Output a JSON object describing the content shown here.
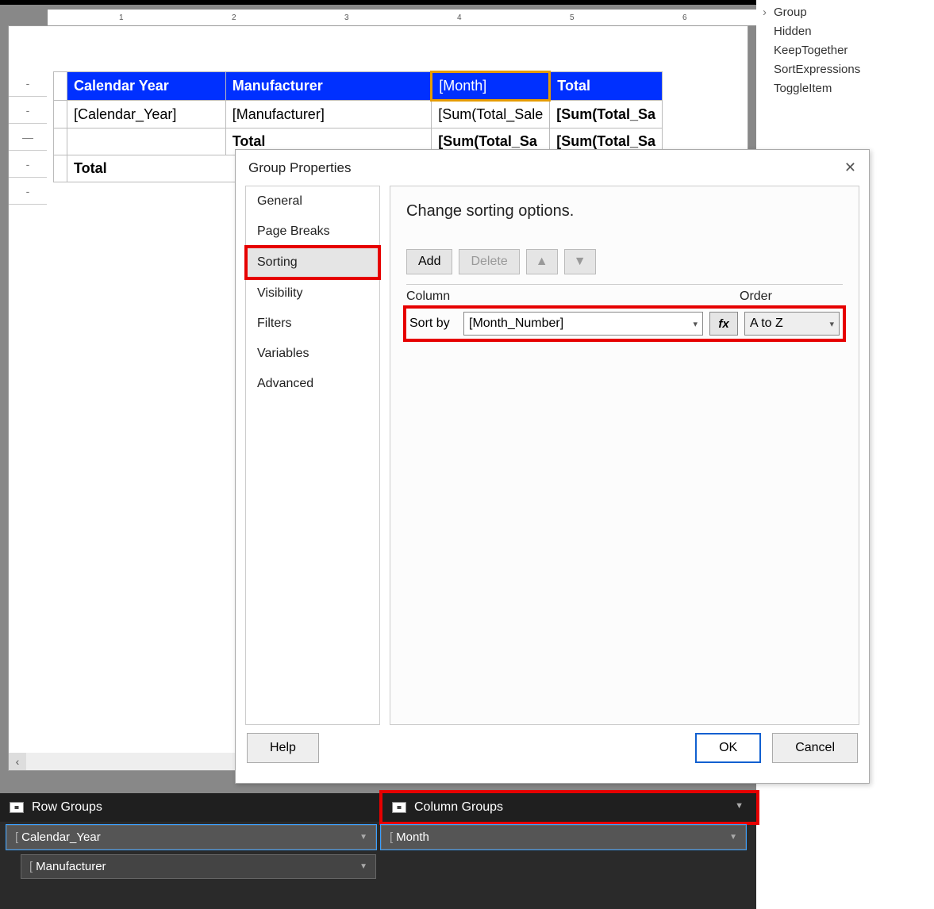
{
  "ruler": {
    "marks": [
      "1",
      "2",
      "3",
      "4",
      "5",
      "6"
    ]
  },
  "tablix": {
    "headers": {
      "c1": "Calendar Year",
      "c2": "Manufacturer",
      "c3": "[Month]",
      "c4": "Total"
    },
    "row1": {
      "c1": "[Calendar_Year]",
      "c2": "[Manufacturer]",
      "c3": "[Sum(Total_Sale",
      "c4": "[Sum(Total_Sa"
    },
    "row2": {
      "c1": "",
      "c2": "Total",
      "c3": "[Sum(Total_Sa",
      "c4": "[Sum(Total_Sa"
    },
    "row3": {
      "c1": "Total",
      "c2": "",
      "c3": "",
      "c4": ""
    }
  },
  "props": {
    "p1": "Group",
    "p2": "Hidden",
    "p3": "KeepTogether",
    "p4": "SortExpressions",
    "p5": "ToggleItem"
  },
  "dialog": {
    "title": "Group Properties",
    "nav": {
      "general": "General",
      "pagebreaks": "Page Breaks",
      "sorting": "Sorting",
      "visibility": "Visibility",
      "filters": "Filters",
      "variables": "Variables",
      "advanced": "Advanced"
    },
    "desc": "Change sorting options.",
    "toolbar": {
      "add": "Add",
      "delete": "Delete"
    },
    "grid": {
      "column_hdr": "Column",
      "order_hdr": "Order",
      "sortby_label": "Sort by",
      "sortby_value": "[Month_Number]",
      "fx": "fx",
      "order_value": "A to Z"
    },
    "footer": {
      "help": "Help",
      "ok": "OK",
      "cancel": "Cancel"
    }
  },
  "groups": {
    "row_hdr": "Row Groups",
    "col_hdr": "Column Groups",
    "row_items": {
      "i1": "Calendar_Year",
      "i2": "Manufacturer"
    },
    "col_items": {
      "i1": "Month"
    }
  }
}
